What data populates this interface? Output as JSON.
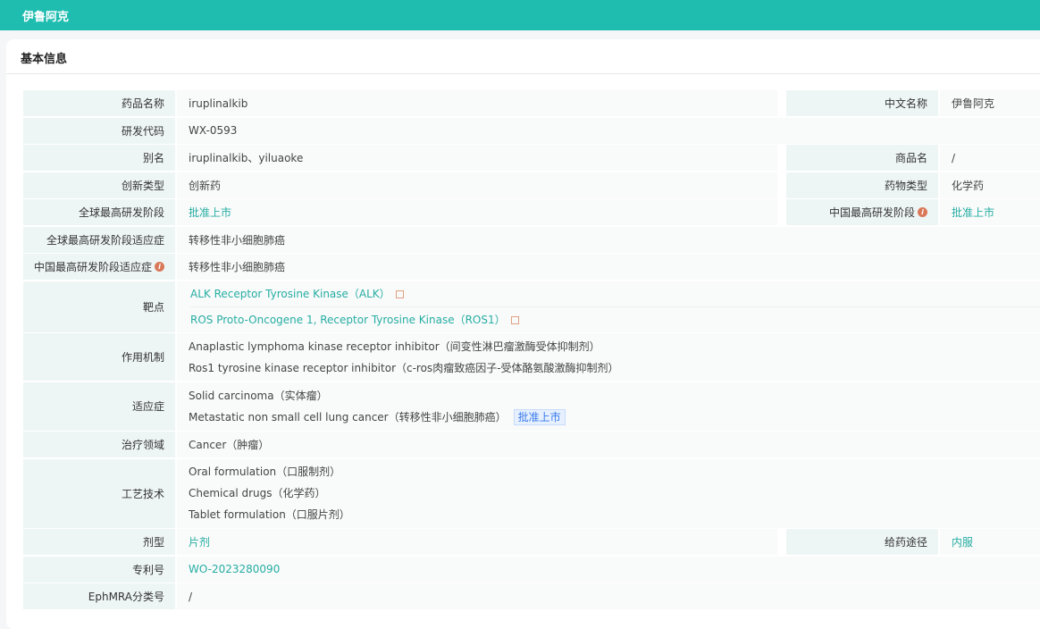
{
  "header": {
    "title": "伊鲁阿克"
  },
  "section": {
    "title": "基本信息"
  },
  "fields": {
    "drug_name": {
      "label": "药品名称",
      "value": "iruplinalkib"
    },
    "cn_name": {
      "label": "中文名称",
      "value": "伊鲁阿克"
    },
    "code": {
      "label": "研发代码",
      "value": "WX-0593"
    },
    "alias": {
      "label": "别名",
      "value": "iruplinalkib、yiluaoke"
    },
    "trade_name": {
      "label": "商品名",
      "value": "/"
    },
    "innov_type": {
      "label": "创新类型",
      "value": "创新药"
    },
    "drug_type": {
      "label": "药物类型",
      "value": "化学药"
    },
    "global_stage": {
      "label": "全球最高研发阶段",
      "value": "批准上市"
    },
    "china_stage": {
      "label": "中国最高研发阶段",
      "value": "批准上市"
    },
    "global_ind": {
      "label": "全球最高研发阶段适应症",
      "value": "转移性非小细胞肺癌"
    },
    "china_ind": {
      "label": "中国最高研发阶段适应症",
      "value": "转移性非小细胞肺癌"
    },
    "target": {
      "label": "靶点",
      "values": [
        "ALK Receptor Tyrosine Kinase（ALK）",
        "ROS Proto-Oncogene 1, Receptor Tyrosine Kinase（ROS1）"
      ]
    },
    "mechanism": {
      "label": "作用机制",
      "values": [
        "Anaplastic lymphoma kinase receptor inhibitor（间变性淋巴瘤激酶受体抑制剂）",
        "Ros1 tyrosine kinase receptor inhibitor（c-ros肉瘤致癌因子-受体酪氨酸激酶抑制剂）"
      ]
    },
    "indication": {
      "label": "适应症",
      "values": [
        "Solid carcinoma（实体瘤）",
        "Metastatic non small cell lung cancer（转移性非小细胞肺癌）"
      ],
      "badge": "批准上市"
    },
    "area": {
      "label": "治疗领域",
      "value": "Cancer（肿瘤）"
    },
    "tech": {
      "label": "工艺技术",
      "values": [
        "Oral formulation（口服制剂）",
        "Chemical drugs（化学药）",
        "Tablet formulation（口服片剂）"
      ]
    },
    "form": {
      "label": "剂型",
      "value": "片剂"
    },
    "route": {
      "label": "给药途径",
      "value": "内服"
    },
    "patent": {
      "label": "专利号",
      "value": "WO-2023280090"
    },
    "ephmra": {
      "label": "EphMRA分类号",
      "value": "/"
    }
  }
}
